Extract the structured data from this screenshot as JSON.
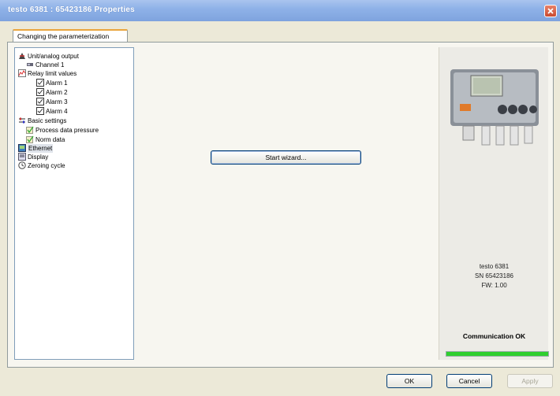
{
  "window": {
    "title": "testo 6381 : 65423186 Properties"
  },
  "tabs": [
    {
      "label": "Changing the parameterization"
    }
  ],
  "tree": {
    "items": [
      {
        "label": "Unit/analog output",
        "icon": "output-icon"
      },
      {
        "label": "Channel 1",
        "icon": "channel-icon"
      },
      {
        "label": "Relay limit values",
        "icon": "chart-icon"
      },
      {
        "label": "Alarm 1",
        "icon": "alarm-icon"
      },
      {
        "label": "Alarm 2",
        "icon": "alarm-icon"
      },
      {
        "label": "Alarm 3",
        "icon": "alarm-icon"
      },
      {
        "label": "Alarm 4",
        "icon": "alarm-icon"
      },
      {
        "label": "Basic settings",
        "icon": "settings-icon"
      },
      {
        "label": "Process data pressure",
        "icon": "checkbox-icon"
      },
      {
        "label": "Norm data",
        "icon": "checkbox-icon"
      },
      {
        "label": "Ethernet",
        "icon": "ethernet-icon",
        "selected": true
      },
      {
        "label": "Display",
        "icon": "display-icon"
      },
      {
        "label": "Zeroing cycle",
        "icon": "clock-icon"
      }
    ]
  },
  "main": {
    "wizard_label": "Start wizard..."
  },
  "device": {
    "model": "testo 6381",
    "serial": "SN 65423186",
    "firmware": "FW: 1.00",
    "status": "Communication OK",
    "status_color": "#2fcf2f",
    "status_progress": 1.0
  },
  "footer": {
    "ok_label": "OK",
    "cancel_label": "Cancel",
    "apply_label": "Apply"
  }
}
